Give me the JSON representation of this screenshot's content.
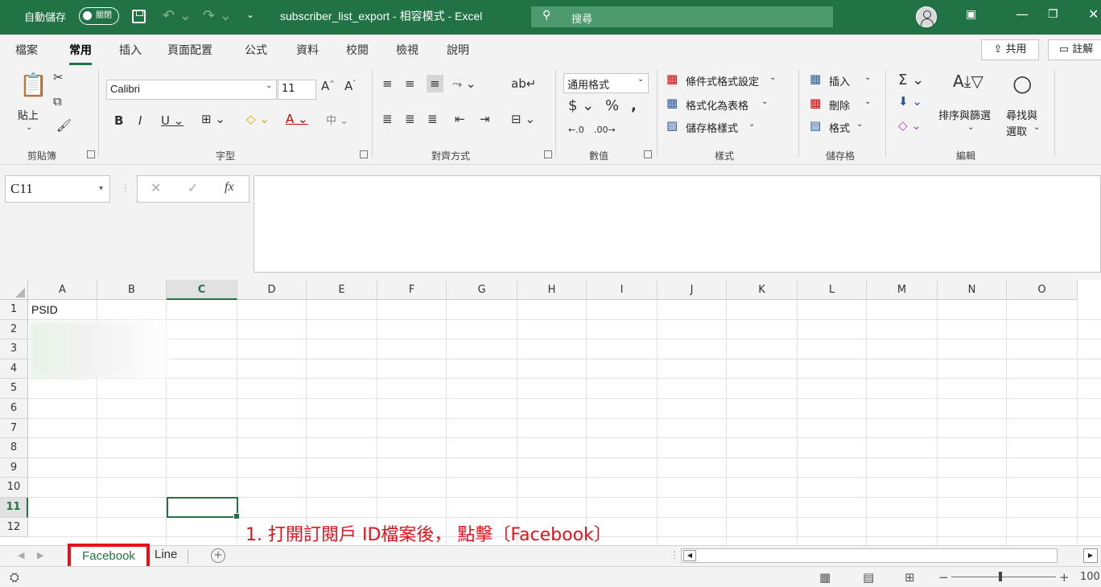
{
  "titlebar": {
    "autosave_label": "自動儲存",
    "autosave_state": "關閉",
    "qat_more": "⌄",
    "title": "subscriber_list_export  -  相容模式  -  Excel",
    "search_placeholder": "搜尋",
    "accent": "#217346"
  },
  "tabs": [
    "檔案",
    "常用",
    "插入",
    "頁面配置",
    "公式",
    "資料",
    "校閱",
    "檢視",
    "說明"
  ],
  "share_label": "共用",
  "comment_label": "註解",
  "ribbon": {
    "clipboard": {
      "paste": "貼上",
      "label": "剪貼簿"
    },
    "font": {
      "name": "Calibri",
      "size": "11",
      "label": "字型"
    },
    "alignment": {
      "label": "對齊方式"
    },
    "number": {
      "format": "通用格式",
      "label": "數值"
    },
    "styles": {
      "conditional": "條件式格式設定",
      "as_table": "格式化為表格",
      "cell_styles": "儲存格樣式",
      "label": "樣式"
    },
    "cells": {
      "insert": "插入",
      "delete": "刪除",
      "format": "格式",
      "label": "儲存格"
    },
    "editing": {
      "sort": "排序與篩選",
      "find": "尋找與",
      "find2": "選取",
      "label": "編輯"
    }
  },
  "formula_bar": {
    "name_box": "C11",
    "fx": "fx"
  },
  "grid": {
    "columns": [
      "A",
      "B",
      "C",
      "D",
      "E",
      "F",
      "G",
      "H",
      "I",
      "J",
      "K",
      "L",
      "M",
      "N",
      "O"
    ],
    "rows": [
      "1",
      "2",
      "3",
      "4",
      "5",
      "6",
      "7",
      "8",
      "9",
      "10",
      "11",
      "12"
    ],
    "cell_a1": "PSID",
    "selected_col": "C",
    "selected_row": "11"
  },
  "annotation": "1. 打開訂閱戶 ID檔案後， 點擊〔Facebook〕",
  "sheets": {
    "active": "Facebook",
    "other": "Line"
  },
  "status": {
    "zoom": "100"
  }
}
